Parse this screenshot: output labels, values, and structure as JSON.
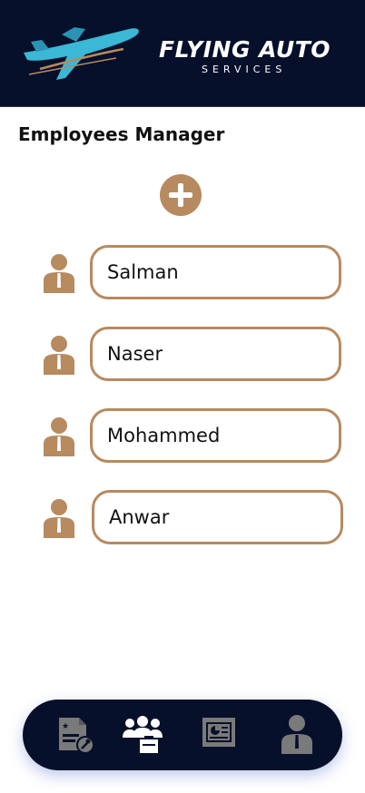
{
  "colors": {
    "header_bg": "#06102a",
    "accent": "#b78a5f",
    "nav_bg": "#06102a",
    "nav_icon_inactive": "#7a7a7a",
    "nav_icon_active": "#ffffff"
  },
  "header": {
    "brand_title": "FLYING AUTO",
    "brand_subtitle": "SERVICES"
  },
  "page": {
    "title": "Employees Manager",
    "add_icon": "plus-circle-icon"
  },
  "employees": [
    {
      "name": "Salman",
      "icon": "person-icon"
    },
    {
      "name": "Naser",
      "icon": "person-icon"
    },
    {
      "name": "Mohammed",
      "icon": "person-icon"
    },
    {
      "name": "Anwar",
      "icon": "person-icon"
    }
  ],
  "bottom_nav": {
    "items": [
      {
        "icon": "service-document-icon",
        "active": false
      },
      {
        "icon": "employees-icon",
        "active": true
      },
      {
        "icon": "presentation-icon",
        "active": false
      },
      {
        "icon": "profile-icon",
        "active": false
      }
    ]
  }
}
